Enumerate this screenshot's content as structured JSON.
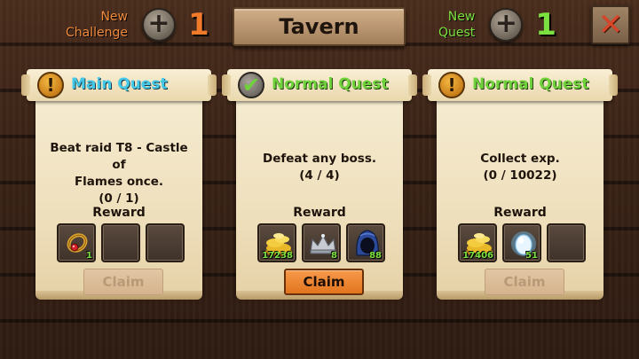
{
  "header": {
    "new_challenge_label_line1": "New",
    "new_challenge_label_line2": "Challenge",
    "new_challenge_count": "1",
    "title": "Tavern",
    "new_quest_label_line1": "New",
    "new_quest_label_line2": "Quest",
    "new_quest_count": "1",
    "close_icon": "close-icon",
    "plus_icon": "plus-icon"
  },
  "quests": [
    {
      "type": "Main Quest",
      "badge": "exclamation-icon",
      "description_line1": "Beat raid T8 - Castle of",
      "description_line2": "Flames once.",
      "progress": "(0 / 1)",
      "reward_label": "Reward",
      "rewards": [
        {
          "item": "ring-icon",
          "qty": "1"
        },
        {
          "item": "empty",
          "qty": ""
        },
        {
          "item": "empty",
          "qty": ""
        }
      ],
      "claim_label": "Claim",
      "claim_enabled": false
    },
    {
      "type": "Normal Quest",
      "badge": "checkmark-icon",
      "description_line1": "Defeat any boss.",
      "description_line2": "",
      "progress": "(4 / 4)",
      "reward_label": "Reward",
      "rewards": [
        {
          "item": "gold-coins-icon",
          "qty": "17238"
        },
        {
          "item": "silver-crown-icon",
          "qty": "8"
        },
        {
          "item": "blue-hood-icon",
          "qty": "88"
        }
      ],
      "claim_label": "Claim",
      "claim_enabled": true
    },
    {
      "type": "Normal Quest",
      "badge": "exclamation-icon",
      "description_line1": "Collect exp.",
      "description_line2": "",
      "progress": "(0 / 10022)",
      "reward_label": "Reward",
      "rewards": [
        {
          "item": "gold-coins-icon",
          "qty": "17406"
        },
        {
          "item": "crystal-egg-icon",
          "qty": "51"
        },
        {
          "item": "empty",
          "qty": ""
        }
      ],
      "claim_label": "Claim",
      "claim_enabled": false
    }
  ],
  "colors": {
    "challenge_accent": "#f07a2a",
    "quest_accent": "#7be040",
    "main_quest_title": "#43c8e8",
    "normal_quest_title": "#6fd23a",
    "claim_active": "#e2741e"
  }
}
